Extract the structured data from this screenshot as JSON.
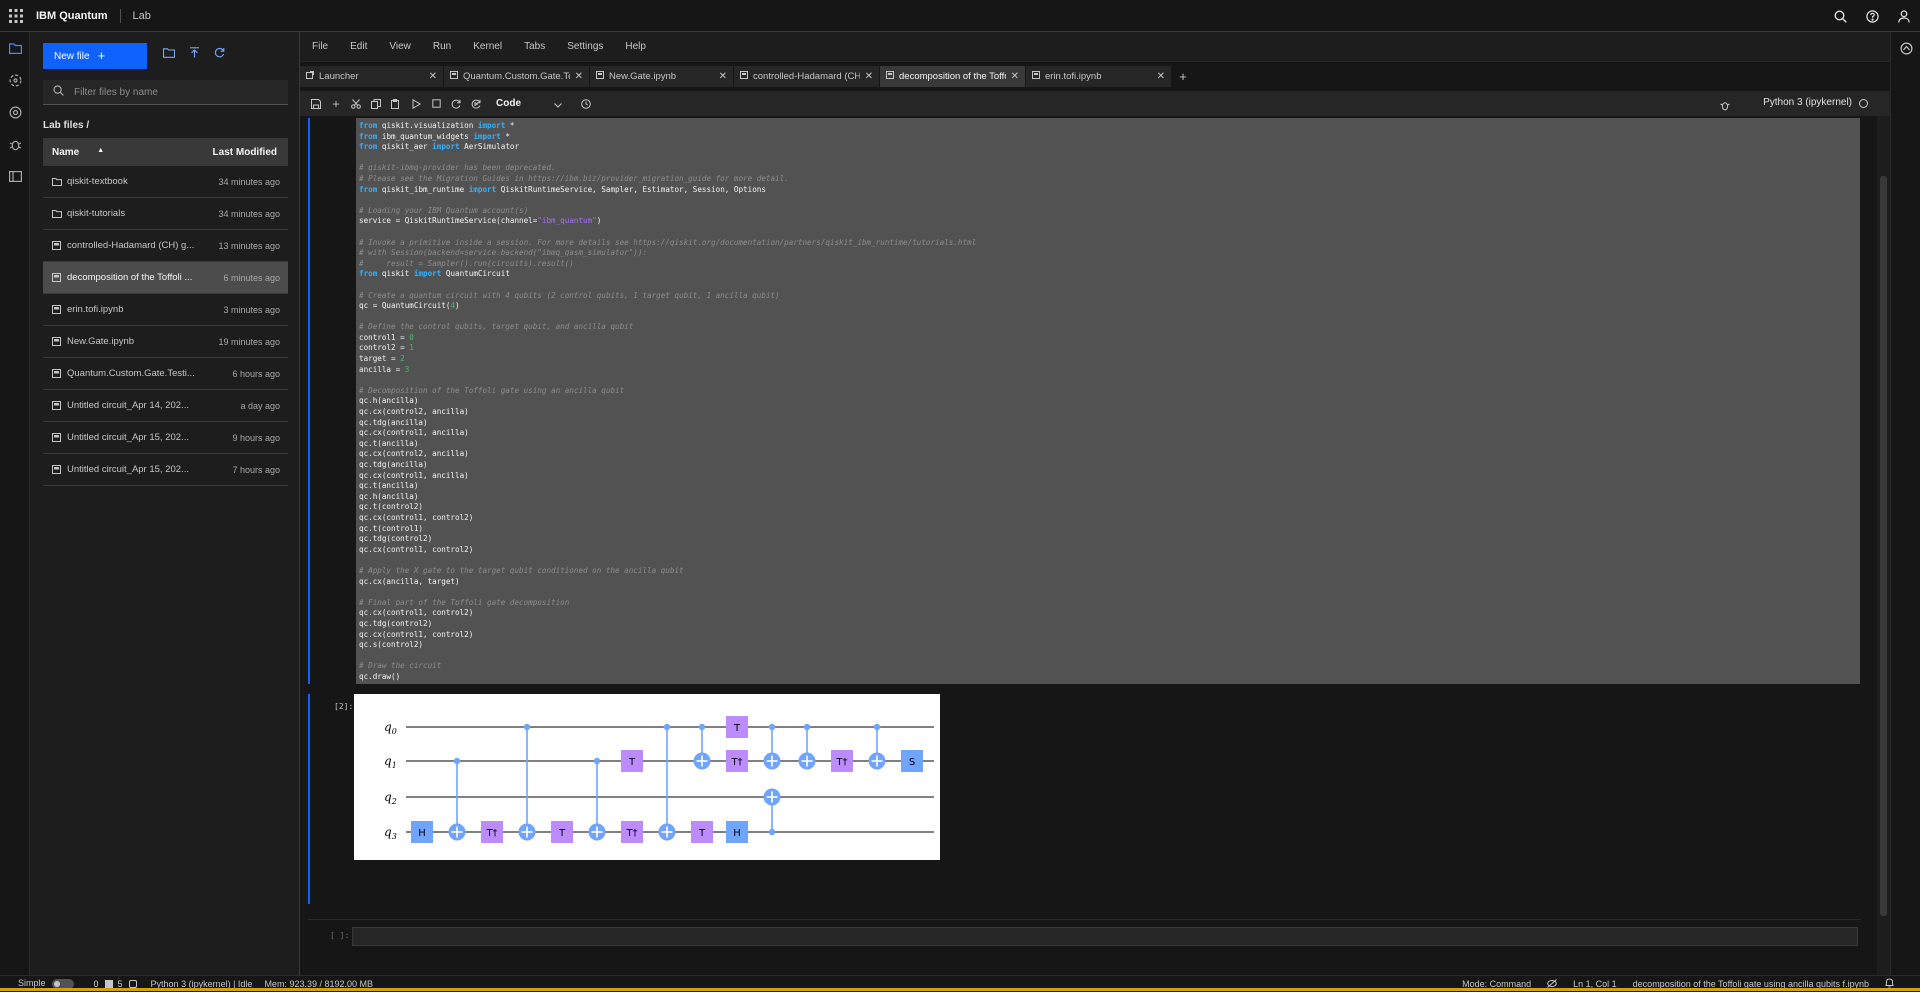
{
  "topbar": {
    "brand": "IBM Quantum",
    "app": "Lab",
    "icons": [
      "search-icon",
      "help-icon",
      "user-icon"
    ]
  },
  "sidebar": {
    "new_file": "New file",
    "filter_placeholder": "Filter files by name",
    "breadcrumb": "Lab files /",
    "columns": {
      "name": "Name",
      "modified": "Last Modified"
    },
    "files": [
      {
        "type": "folder",
        "name": "qiskit-textbook",
        "modified": "34 minutes ago"
      },
      {
        "type": "folder",
        "name": "qiskit-tutorials",
        "modified": "34 minutes ago"
      },
      {
        "type": "notebook",
        "name": "controlled-Hadamard (CH) g...",
        "modified": "13 minutes ago"
      },
      {
        "type": "notebook",
        "name": "decomposition of the Toffoli ...",
        "modified": "6 minutes ago",
        "selected": true
      },
      {
        "type": "notebook",
        "name": "erin.tofi.ipynb",
        "modified": "3 minutes ago"
      },
      {
        "type": "notebook",
        "name": "New.Gate.ipynb",
        "modified": "19 minutes ago"
      },
      {
        "type": "notebook",
        "name": "Quantum.Custom.Gate.Testi...",
        "modified": "6 hours ago"
      },
      {
        "type": "notebook",
        "name": "Untitled circuit_Apr 14, 202...",
        "modified": "a day ago"
      },
      {
        "type": "notebook",
        "name": "Untitled circuit_Apr 15, 202...",
        "modified": "9 hours ago"
      },
      {
        "type": "notebook",
        "name": "Untitled circuit_Apr 15, 202...",
        "modified": "7 hours ago"
      }
    ]
  },
  "menu": [
    "File",
    "Edit",
    "View",
    "Run",
    "Kernel",
    "Tabs",
    "Settings",
    "Help"
  ],
  "tabs": [
    {
      "label": "Launcher",
      "icon": "launcher-icon"
    },
    {
      "label": "Quantum.Custom.Gate.Te:",
      "icon": "notebook-icon"
    },
    {
      "label": "New.Gate.ipynb",
      "icon": "notebook-icon"
    },
    {
      "label": "controlled-Hadamard (CH",
      "icon": "notebook-icon"
    },
    {
      "label": "decomposition of the Toffc",
      "icon": "notebook-icon",
      "active": true
    },
    {
      "label": "erin.tofi.ipynb",
      "icon": "notebook-icon"
    }
  ],
  "toolbar": {
    "cell_type": "Code",
    "kernel": "Python 3 (ipykernel)"
  },
  "notebook": {
    "code_lines": [
      [
        [
          "k",
          "from"
        ],
        [
          "t",
          " qiskit.visualization "
        ],
        [
          "k",
          "import"
        ],
        [
          "t",
          " *"
        ]
      ],
      [
        [
          "k",
          "from"
        ],
        [
          "t",
          " ibm_quantum_widgets "
        ],
        [
          "k",
          "import"
        ],
        [
          "t",
          " *"
        ]
      ],
      [
        [
          "k",
          "from"
        ],
        [
          "t",
          " qiskit_aer "
        ],
        [
          "k",
          "import"
        ],
        [
          "t",
          " AerSimulator"
        ]
      ],
      [],
      [
        [
          "c",
          "# qiskit-ibmq-provider has been deprecated."
        ]
      ],
      [
        [
          "c",
          "# Please see the Migration Guides in https://ibm.biz/provider_migration_guide for more detail."
        ]
      ],
      [
        [
          "k",
          "from"
        ],
        [
          "t",
          " qiskit_ibm_runtime "
        ],
        [
          "k",
          "import"
        ],
        [
          "t",
          " QiskitRuntimeService, Sampler, Estimator, Session, Options"
        ]
      ],
      [],
      [
        [
          "c",
          "# Loading your IBM Quantum account(s)"
        ]
      ],
      [
        [
          "t",
          "service = QiskitRuntimeService(channel="
        ],
        [
          "s",
          "\"ibm_quantum\""
        ],
        [
          "t",
          ")"
        ]
      ],
      [],
      [
        [
          "c",
          "# Invoke a primitive inside a session. For more details see https://qiskit.org/documentation/partners/qiskit_ibm_runtime/tutorials.html"
        ]
      ],
      [
        [
          "c",
          "# with Session(backend=service.backend(\"ibmq_qasm_simulator\")):"
        ]
      ],
      [
        [
          "c",
          "#     result = Sampler().run(circuits).result()"
        ]
      ],
      [
        [
          "k",
          "from"
        ],
        [
          "t",
          " qiskit "
        ],
        [
          "k",
          "import"
        ],
        [
          "t",
          " QuantumCircuit"
        ]
      ],
      [],
      [
        [
          "c",
          "# Create a quantum circuit with 4 qubits (2 control qubits, 1 target qubit, 1 ancilla qubit)"
        ]
      ],
      [
        [
          "t",
          "qc = QuantumCircuit("
        ],
        [
          "n",
          "4"
        ],
        [
          "t",
          ")"
        ]
      ],
      [],
      [
        [
          "c",
          "# Define the control qubits, target qubit, and ancilla qubit"
        ]
      ],
      [
        [
          "t",
          "control1 = "
        ],
        [
          "n",
          "0"
        ]
      ],
      [
        [
          "t",
          "control2 = "
        ],
        [
          "n",
          "1"
        ]
      ],
      [
        [
          "t",
          "target = "
        ],
        [
          "n",
          "2"
        ]
      ],
      [
        [
          "t",
          "ancilla = "
        ],
        [
          "n",
          "3"
        ]
      ],
      [],
      [
        [
          "c",
          "# Decomposition of the Toffoli gate using an ancilla qubit"
        ]
      ],
      [
        [
          "t",
          "qc.h(ancilla)"
        ]
      ],
      [
        [
          "t",
          "qc.cx(control2, ancilla)"
        ]
      ],
      [
        [
          "t",
          "qc.tdg(ancilla)"
        ]
      ],
      [
        [
          "t",
          "qc.cx(control1, ancilla)"
        ]
      ],
      [
        [
          "t",
          "qc.t(ancilla)"
        ]
      ],
      [
        [
          "t",
          "qc.cx(control2, ancilla)"
        ]
      ],
      [
        [
          "t",
          "qc.tdg(ancilla)"
        ]
      ],
      [
        [
          "t",
          "qc.cx(control1, ancilla)"
        ]
      ],
      [
        [
          "t",
          "qc.t(ancilla)"
        ]
      ],
      [
        [
          "t",
          "qc.h(ancilla)"
        ]
      ],
      [
        [
          "t",
          "qc.t(control2)"
        ]
      ],
      [
        [
          "t",
          "qc.cx(control1, control2)"
        ]
      ],
      [
        [
          "t",
          "qc.t(control1)"
        ]
      ],
      [
        [
          "t",
          "qc.tdg(control2)"
        ]
      ],
      [
        [
          "t",
          "qc.cx(control1, control2)"
        ]
      ],
      [],
      [
        [
          "c",
          "# Apply the X gate to the target qubit conditioned on the ancilla qubit"
        ]
      ],
      [
        [
          "t",
          "qc.cx(ancilla, target)"
        ]
      ],
      [],
      [
        [
          "c",
          "# Final part of the Toffoli gate decomposition"
        ]
      ],
      [
        [
          "t",
          "qc.cx(control1, control2)"
        ]
      ],
      [
        [
          "t",
          "qc.tdg(control2)"
        ]
      ],
      [
        [
          "t",
          "qc.cx(control1, control2)"
        ]
      ],
      [
        [
          "t",
          "qc.s(control2)"
        ]
      ],
      [],
      [
        [
          "c",
          "# Draw the circuit"
        ]
      ],
      [
        [
          "t",
          "qc.draw()"
        ]
      ]
    ],
    "output_prompt": "[2]:",
    "empty_prompt": "[ ]:",
    "circuit": {
      "qubits": [
        "q0",
        "q1",
        "q2",
        "q3"
      ],
      "gates": [
        {
          "col": 0,
          "type": "single",
          "q": 3,
          "label": "H",
          "color": "#6fa4ff"
        },
        {
          "col": 1,
          "type": "cx",
          "ctrl": 1,
          "tgt": 3
        },
        {
          "col": 2,
          "type": "single",
          "q": 3,
          "label": "T†",
          "color": "#bb8bff"
        },
        {
          "col": 3,
          "type": "cx",
          "ctrl": 0,
          "tgt": 3
        },
        {
          "col": 4,
          "type": "single",
          "q": 3,
          "label": "T",
          "color": "#bb8bff"
        },
        {
          "col": 5,
          "type": "cx",
          "ctrl": 1,
          "tgt": 3
        },
        {
          "col": 6,
          "type": "single",
          "q": 1,
          "label": "T",
          "color": "#bb8bff"
        },
        {
          "col": 6,
          "type": "single",
          "q": 3,
          "label": "T†",
          "color": "#bb8bff"
        },
        {
          "col": 7,
          "type": "cx",
          "ctrl": 0,
          "tgt": 3
        },
        {
          "col": 8,
          "type": "cx",
          "ctrl": 0,
          "tgt": 1
        },
        {
          "col": 8,
          "type": "single",
          "q": 3,
          "label": "T",
          "color": "#bb8bff"
        },
        {
          "col": 9,
          "type": "single",
          "q": 0,
          "label": "T",
          "color": "#bb8bff"
        },
        {
          "col": 9,
          "type": "single",
          "q": 1,
          "label": "T†",
          "color": "#bb8bff"
        },
        {
          "col": 9,
          "type": "single",
          "q": 3,
          "label": "H",
          "color": "#6fa4ff"
        },
        {
          "col": 10,
          "type": "cx",
          "ctrl": 0,
          "tgt": 1
        },
        {
          "col": 10,
          "type": "cx",
          "ctrl": 3,
          "tgt": 2
        },
        {
          "col": 11,
          "type": "cx",
          "ctrl": 0,
          "tgt": 1
        },
        {
          "col": 12,
          "type": "single",
          "q": 1,
          "label": "T†",
          "color": "#bb8bff"
        },
        {
          "col": 13,
          "type": "cx",
          "ctrl": 0,
          "tgt": 1
        },
        {
          "col": 14,
          "type": "single",
          "q": 1,
          "label": "S",
          "color": "#6fa4ff"
        }
      ]
    }
  },
  "status": {
    "mode_label": "Simple",
    "counts": "0",
    "terminals": "5",
    "kernel": "Python 3 (ipykernel) | Idle",
    "mem": "Mem: 923.39 / 8192.00 MB",
    "mode": "Mode: Command",
    "position": "Ln 1, Col 1",
    "file": "decomposition of the Toffoli gate using ancilla qubits f.ipynb"
  },
  "colors": {
    "accent": "#0f62fe",
    "gate_blue": "#6fa4ff",
    "gate_purple": "#bb8bff",
    "bottom_bar": "#d2a106"
  }
}
